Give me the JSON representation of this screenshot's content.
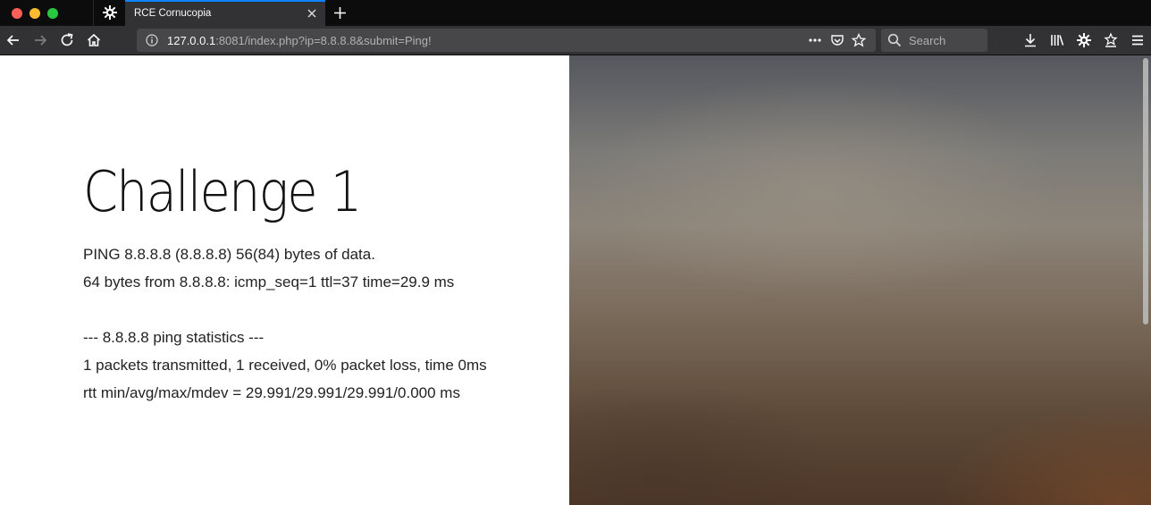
{
  "browser": {
    "tab": {
      "title": "RCE Cornucopia",
      "icon": "gear-icon"
    },
    "address": {
      "host": "127.0.0.1",
      "rest": ":8081/index.php?ip=8.8.8.8&submit=Ping!"
    },
    "search": {
      "placeholder": "Search"
    },
    "icons": {
      "back": "arrow-left-icon",
      "forward": "arrow-right-icon",
      "reload": "reload-icon",
      "home": "home-icon",
      "page_actions": "more-dots-icon",
      "pocket": "pocket-icon",
      "bookmark": "star-icon",
      "downloads": "download-icon",
      "library": "library-icon",
      "extensions": "gear-icon",
      "bookmarks_toolbar": "star-list-icon",
      "menu": "hamburger-icon"
    },
    "colors": {
      "tab_accent": "#0a84ff",
      "chrome_dark": "#0c0c0d",
      "toolbar": "#323234"
    }
  },
  "page": {
    "heading": "Challenge 1",
    "output_lines": [
      "PING 8.8.8.8 (8.8.8.8) 56(84) bytes of data.",
      "64 bytes from 8.8.8.8: icmp_seq=1 ttl=37 time=29.9 ms",
      "",
      "--- 8.8.8.8 ping statistics ---",
      "1 packets transmitted, 1 received, 0% packet loss, time 0ms",
      "rtt min/avg/max/mdev = 29.991/29.991/29.991/0.000 ms"
    ]
  }
}
